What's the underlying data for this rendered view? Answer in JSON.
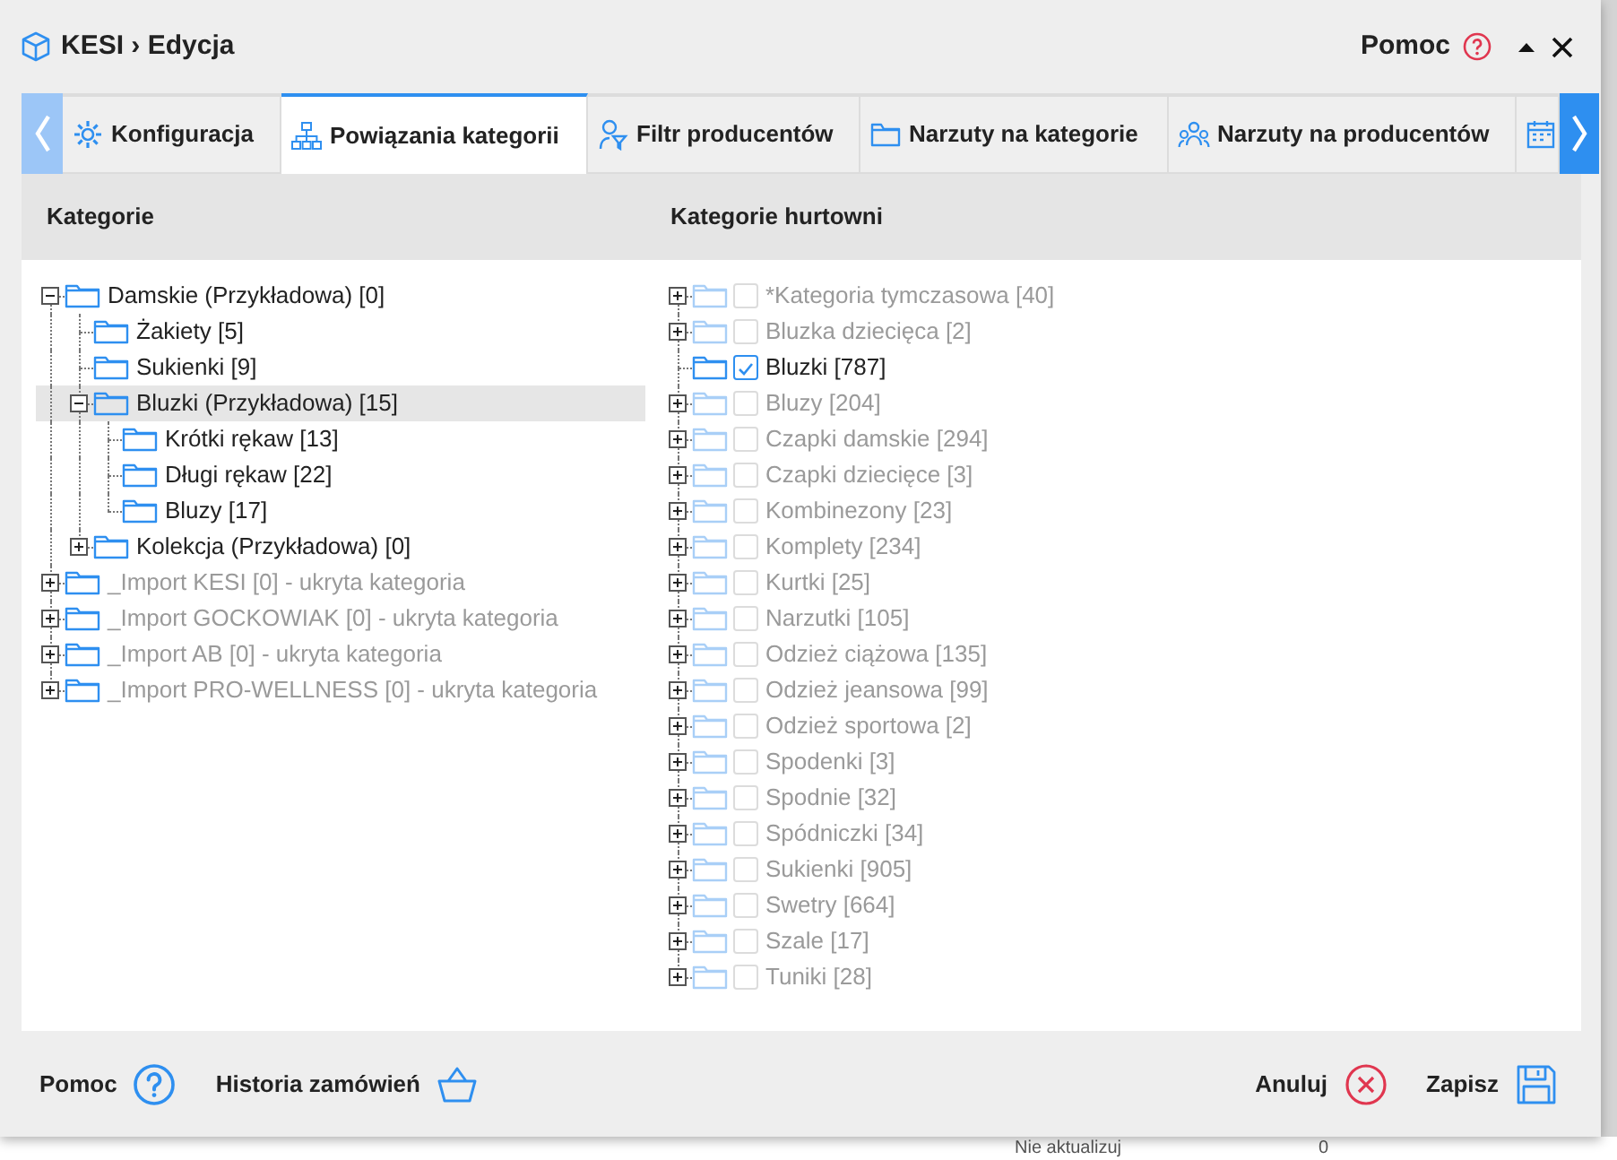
{
  "window": {
    "title": "KESI › Edycja",
    "help_label": "Pomoc"
  },
  "tabs": [
    {
      "label": "Konfiguracja",
      "selected": false
    },
    {
      "label": "Powiązania kategorii",
      "selected": true
    },
    {
      "label": "Filtr producentów",
      "selected": false
    },
    {
      "label": "Narzuty na kategorie",
      "selected": false
    },
    {
      "label": "Narzuty na producentów",
      "selected": false
    },
    {
      "selected": false
    }
  ],
  "columns": [
    "Kategorie",
    "Kategorie hurtowni"
  ],
  "categories": [
    {
      "label": "Damskie (Przykładowa) [0]",
      "expanded": true,
      "selected": false,
      "dimmed": false,
      "children": [
        {
          "label": "Żakiety [5]",
          "selected": false,
          "dimmed": false
        },
        {
          "label": "Sukienki [9]",
          "selected": false,
          "dimmed": false
        },
        {
          "label": "Bluzki (Przykładowa) [15]",
          "expanded": true,
          "selected": true,
          "dimmed": false,
          "children": [
            {
              "label": "Krótki rękaw [13]",
              "selected": false,
              "dimmed": false
            },
            {
              "label": "Długi rękaw [22]",
              "selected": false,
              "dimmed": false
            },
            {
              "label": "Bluzy [17]",
              "selected": false,
              "dimmed": false
            }
          ]
        },
        {
          "label": "Kolekcja (Przykładowa) [0]",
          "expanded": false,
          "selected": false,
          "dimmed": false
        }
      ]
    },
    {
      "label": "_Import KESI [0] - ukryta kategoria",
      "expanded": false,
      "selected": false,
      "dimmed": true
    },
    {
      "label": "_Import GOCKOWIAK [0] - ukryta kategoria",
      "expanded": false,
      "selected": false,
      "dimmed": true
    },
    {
      "label": "_Import AB [0] - ukryta kategoria",
      "expanded": false,
      "selected": false,
      "dimmed": true
    },
    {
      "label": "_Import PRO-WELLNESS [0] - ukryta kategoria",
      "expanded": false,
      "selected": false,
      "dimmed": true
    }
  ],
  "wholesale_categories": [
    {
      "label": "*Kategoria tymczasowa [40]",
      "expanded": false,
      "checked": false
    },
    {
      "label": "Bluzka dziecięca [2]",
      "expanded": false,
      "checked": false
    },
    {
      "label": "Bluzki [787]",
      "checked": true
    },
    {
      "label": "Bluzy [204]",
      "expanded": false,
      "checked": false
    },
    {
      "label": "Czapki damskie [294]",
      "expanded": false,
      "checked": false
    },
    {
      "label": "Czapki dziecięce [3]",
      "expanded": false,
      "checked": false
    },
    {
      "label": "Kombinezony [23]",
      "expanded": false,
      "checked": false
    },
    {
      "label": "Komplety [234]",
      "expanded": false,
      "checked": false
    },
    {
      "label": "Kurtki [25]",
      "expanded": false,
      "checked": false
    },
    {
      "label": "Narzutki [105]",
      "expanded": false,
      "checked": false
    },
    {
      "label": "Odzież ciążowa [135]",
      "expanded": false,
      "checked": false
    },
    {
      "label": "Odzież jeansowa [99]",
      "expanded": false,
      "checked": false
    },
    {
      "label": "Odzież sportowa [2]",
      "expanded": false,
      "checked": false
    },
    {
      "label": "Spodenki [3]",
      "expanded": false,
      "checked": false
    },
    {
      "label": "Spodnie [32]",
      "expanded": false,
      "checked": false
    },
    {
      "label": "Spódniczki [34]",
      "expanded": false,
      "checked": false
    },
    {
      "label": "Sukienki [905]",
      "expanded": false,
      "checked": false
    },
    {
      "label": "Swetry [664]",
      "expanded": false,
      "checked": false
    },
    {
      "label": "Szale [17]",
      "expanded": false,
      "checked": false
    },
    {
      "label": "Tuniki [28]",
      "expanded": false,
      "checked": false
    }
  ],
  "footer": {
    "left": [
      {
        "label": "Pomoc"
      },
      {
        "label": "Historia zamówień"
      }
    ],
    "right": [
      {
        "label": "Anuluj"
      },
      {
        "label": "Zapisz"
      }
    ]
  },
  "background_row": [
    "Nie aktualizuj",
    "0"
  ]
}
